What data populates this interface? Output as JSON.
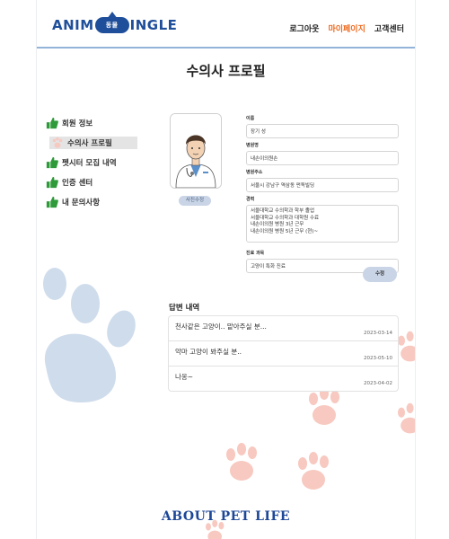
{
  "header": {
    "logo_left": "ANIM",
    "logo_badge": "동물",
    "logo_right": "INGLE",
    "nav": [
      {
        "label": "로그아웃",
        "active": false
      },
      {
        "label": "마이페이지",
        "active": true
      },
      {
        "label": "고객센터",
        "active": false
      }
    ]
  },
  "page_title": "수의사 프로필",
  "sidebar": {
    "items": [
      {
        "label": "회원 정보",
        "icon": "thumbs-up-icon"
      },
      {
        "label": "수의사 프로필",
        "icon": "paw-icon",
        "selected": true
      },
      {
        "label": "펫시터 모집 내역",
        "icon": "thumbs-up-icon"
      },
      {
        "label": "인증 센터",
        "icon": "thumbs-up-icon"
      },
      {
        "label": "내 문의사항",
        "icon": "thumbs-up-icon"
      }
    ]
  },
  "profile": {
    "photo_button": "사진수정",
    "fields": {
      "name_label": "이름",
      "name_value": "장기 성",
      "hospital_label": "병원명",
      "hospital_value": "내손이의원손",
      "address_label": "병원주소",
      "address_value": "서울시 강남구 역삼동 펀독빌딩",
      "career_label": "경력",
      "career_lines": [
        "서울대학교 수의학과 학부 졸업",
        "서울대학교 수의학과 대학원 수료",
        "내손이의원 병원 3년 근무",
        "내손이의원 병원 5년 근무 (현)~"
      ],
      "subject_label": "진료 과목",
      "subject_value": "고양이 특화 진료"
    },
    "edit_button": "수정"
  },
  "answers": {
    "title": "답변 내역",
    "items": [
      {
        "text": "천사같은 고양이.. 맡아주실 분...",
        "date": "2023-03-14"
      },
      {
        "text": "악마 고양이 봐주실 분..",
        "date": "2023-05-10"
      },
      {
        "text": "나옹~",
        "date": "2023-04-02"
      }
    ]
  },
  "footer": "ABOUT PET LIFE",
  "colors": {
    "brand_blue": "#1f4f9a",
    "accent_orange": "#ee6a1e",
    "paw_blue": "#cfdcec",
    "paw_pink": "#f7c9c0",
    "thumb_green": "#2f9a3a"
  }
}
